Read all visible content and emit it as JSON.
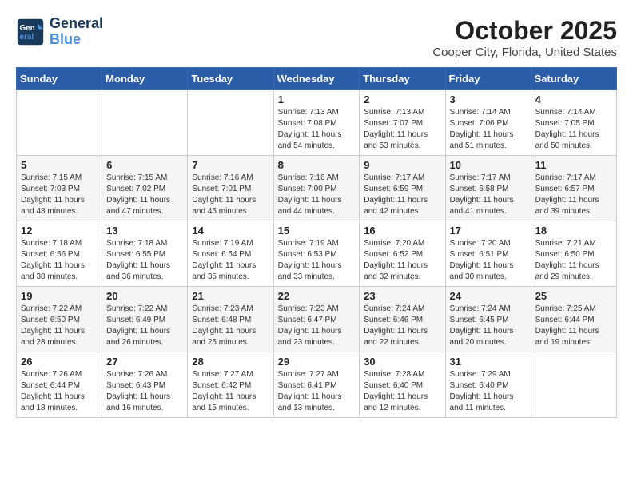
{
  "logo": {
    "line1": "General",
    "line2": "Blue"
  },
  "header": {
    "month": "October 2025",
    "location": "Cooper City, Florida, United States"
  },
  "weekdays": [
    "Sunday",
    "Monday",
    "Tuesday",
    "Wednesday",
    "Thursday",
    "Friday",
    "Saturday"
  ],
  "weeks": [
    [
      {
        "day": "",
        "info": ""
      },
      {
        "day": "",
        "info": ""
      },
      {
        "day": "",
        "info": ""
      },
      {
        "day": "1",
        "info": "Sunrise: 7:13 AM\nSunset: 7:08 PM\nDaylight: 11 hours and 54 minutes."
      },
      {
        "day": "2",
        "info": "Sunrise: 7:13 AM\nSunset: 7:07 PM\nDaylight: 11 hours and 53 minutes."
      },
      {
        "day": "3",
        "info": "Sunrise: 7:14 AM\nSunset: 7:06 PM\nDaylight: 11 hours and 51 minutes."
      },
      {
        "day": "4",
        "info": "Sunrise: 7:14 AM\nSunset: 7:05 PM\nDaylight: 11 hours and 50 minutes."
      }
    ],
    [
      {
        "day": "5",
        "info": "Sunrise: 7:15 AM\nSunset: 7:03 PM\nDaylight: 11 hours and 48 minutes."
      },
      {
        "day": "6",
        "info": "Sunrise: 7:15 AM\nSunset: 7:02 PM\nDaylight: 11 hours and 47 minutes."
      },
      {
        "day": "7",
        "info": "Sunrise: 7:16 AM\nSunset: 7:01 PM\nDaylight: 11 hours and 45 minutes."
      },
      {
        "day": "8",
        "info": "Sunrise: 7:16 AM\nSunset: 7:00 PM\nDaylight: 11 hours and 44 minutes."
      },
      {
        "day": "9",
        "info": "Sunrise: 7:17 AM\nSunset: 6:59 PM\nDaylight: 11 hours and 42 minutes."
      },
      {
        "day": "10",
        "info": "Sunrise: 7:17 AM\nSunset: 6:58 PM\nDaylight: 11 hours and 41 minutes."
      },
      {
        "day": "11",
        "info": "Sunrise: 7:17 AM\nSunset: 6:57 PM\nDaylight: 11 hours and 39 minutes."
      }
    ],
    [
      {
        "day": "12",
        "info": "Sunrise: 7:18 AM\nSunset: 6:56 PM\nDaylight: 11 hours and 38 minutes."
      },
      {
        "day": "13",
        "info": "Sunrise: 7:18 AM\nSunset: 6:55 PM\nDaylight: 11 hours and 36 minutes."
      },
      {
        "day": "14",
        "info": "Sunrise: 7:19 AM\nSunset: 6:54 PM\nDaylight: 11 hours and 35 minutes."
      },
      {
        "day": "15",
        "info": "Sunrise: 7:19 AM\nSunset: 6:53 PM\nDaylight: 11 hours and 33 minutes."
      },
      {
        "day": "16",
        "info": "Sunrise: 7:20 AM\nSunset: 6:52 PM\nDaylight: 11 hours and 32 minutes."
      },
      {
        "day": "17",
        "info": "Sunrise: 7:20 AM\nSunset: 6:51 PM\nDaylight: 11 hours and 30 minutes."
      },
      {
        "day": "18",
        "info": "Sunrise: 7:21 AM\nSunset: 6:50 PM\nDaylight: 11 hours and 29 minutes."
      }
    ],
    [
      {
        "day": "19",
        "info": "Sunrise: 7:22 AM\nSunset: 6:50 PM\nDaylight: 11 hours and 28 minutes."
      },
      {
        "day": "20",
        "info": "Sunrise: 7:22 AM\nSunset: 6:49 PM\nDaylight: 11 hours and 26 minutes."
      },
      {
        "day": "21",
        "info": "Sunrise: 7:23 AM\nSunset: 6:48 PM\nDaylight: 11 hours and 25 minutes."
      },
      {
        "day": "22",
        "info": "Sunrise: 7:23 AM\nSunset: 6:47 PM\nDaylight: 11 hours and 23 minutes."
      },
      {
        "day": "23",
        "info": "Sunrise: 7:24 AM\nSunset: 6:46 PM\nDaylight: 11 hours and 22 minutes."
      },
      {
        "day": "24",
        "info": "Sunrise: 7:24 AM\nSunset: 6:45 PM\nDaylight: 11 hours and 20 minutes."
      },
      {
        "day": "25",
        "info": "Sunrise: 7:25 AM\nSunset: 6:44 PM\nDaylight: 11 hours and 19 minutes."
      }
    ],
    [
      {
        "day": "26",
        "info": "Sunrise: 7:26 AM\nSunset: 6:44 PM\nDaylight: 11 hours and 18 minutes."
      },
      {
        "day": "27",
        "info": "Sunrise: 7:26 AM\nSunset: 6:43 PM\nDaylight: 11 hours and 16 minutes."
      },
      {
        "day": "28",
        "info": "Sunrise: 7:27 AM\nSunset: 6:42 PM\nDaylight: 11 hours and 15 minutes."
      },
      {
        "day": "29",
        "info": "Sunrise: 7:27 AM\nSunset: 6:41 PM\nDaylight: 11 hours and 13 minutes."
      },
      {
        "day": "30",
        "info": "Sunrise: 7:28 AM\nSunset: 6:40 PM\nDaylight: 11 hours and 12 minutes."
      },
      {
        "day": "31",
        "info": "Sunrise: 7:29 AM\nSunset: 6:40 PM\nDaylight: 11 hours and 11 minutes."
      },
      {
        "day": "",
        "info": ""
      }
    ]
  ]
}
